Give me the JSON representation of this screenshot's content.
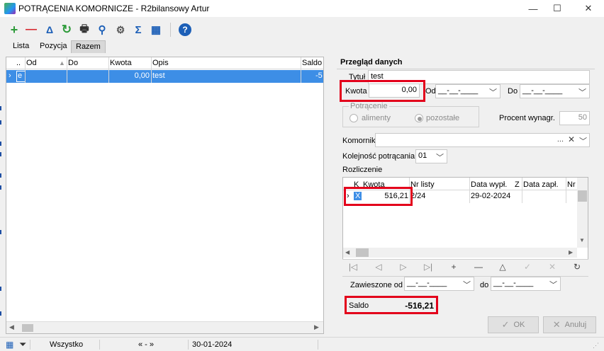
{
  "window": {
    "title": "POTRĄCENIA KOMORNICZE - R2bilansowy Artur",
    "minimize": "—",
    "maximize": "☐",
    "close": "✕"
  },
  "toolbar": {
    "add": "+",
    "remove": "—",
    "delta": "Δ",
    "refresh": "↻",
    "print": "🖶",
    "search": "⚲",
    "settings": "⚙",
    "sum": "Σ",
    "columns": "▦",
    "help": "?"
  },
  "tabs": [
    "Lista",
    "Pozycja",
    "Razem"
  ],
  "grid": {
    "headers": {
      "dots": "..",
      "od": "Od",
      "do": "Do",
      "kwota": "Kwota",
      "opis": "Opis",
      "saldo": "Saldo"
    },
    "rows": [
      {
        "marker": "e",
        "od": "",
        "do": "",
        "kwota": "0,00",
        "opis": "test",
        "saldo": "-5"
      }
    ]
  },
  "details": {
    "section_title": "Przegląd danych",
    "tytul_label": "Tytuł",
    "tytul_value": "test",
    "kwota_label": "Kwota",
    "kwota_value": "0,00",
    "od_label": "Od",
    "od_value": "__-__-____",
    "do_label": "Do",
    "do_value": "__-__-____",
    "potracenie_label": "Potrącenie",
    "aliment_label": "alimenty",
    "pozostale_label": "pozostałe",
    "procent_label": "Procent wynagr.",
    "procent_value": "50",
    "komornik_label": "Komornik",
    "komornik_value": "",
    "kolejnosc_label": "Kolejność potrącania",
    "kolejnosc_value": "01",
    "rozliczenie_label": "Rozliczenie",
    "rozl_headers": {
      "k": "K",
      "kwota": "Kwota",
      "nr": "Nr listy",
      "data_wypl": "Data wypł.",
      "z": "Z",
      "data_zapl": "Data zapł.",
      "nr2": "Nr"
    },
    "rozl_rows": [
      {
        "k": "X",
        "kwota": "516,21",
        "nr": "2/24",
        "data_wypl": "29-02-2024",
        "z": "",
        "data_zapl": ""
      }
    ],
    "zawieszone_label": "Zawieszone od",
    "zawieszone_value": "__-__-____",
    "zaw_do_label": "do",
    "zaw_do_value": "__-__-____",
    "saldo_label": "Saldo",
    "saldo_value": "-516,21",
    "ok_label": "OK",
    "anuluj_label": "Anuluj"
  },
  "status": {
    "filter": "Wszystko",
    "nav": "« - »",
    "date": "30-01-2024"
  },
  "colors": {
    "selection": "#3d8ee6",
    "highlight_red": "#e3001b"
  }
}
